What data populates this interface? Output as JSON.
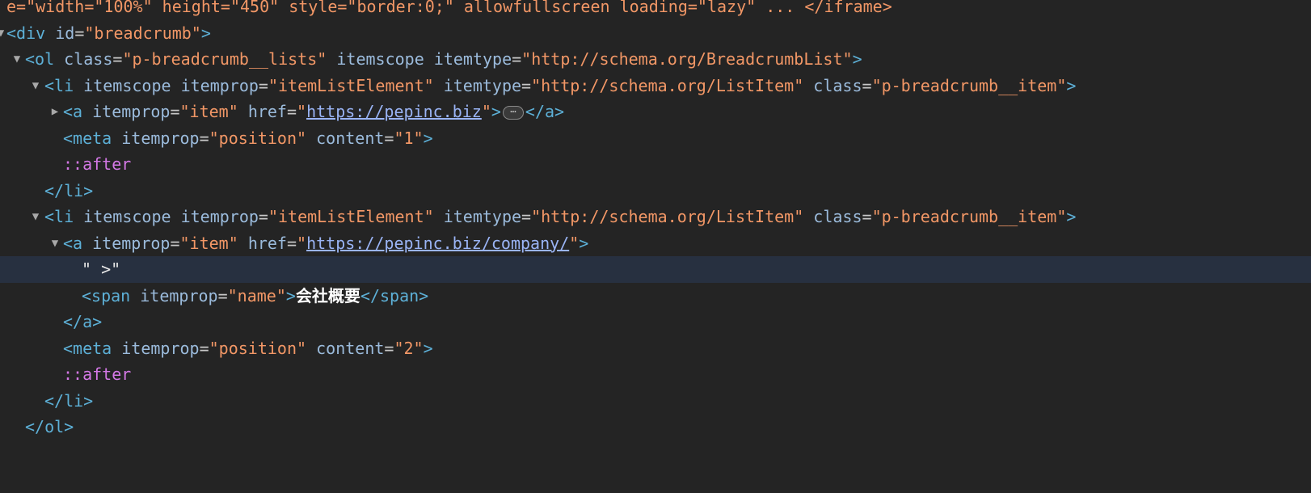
{
  "top_cut_line": "e=\"width=\"100%\" height=\"450\" style=\"border:0;\" allowfullscreen loading=\"lazy\" ... </iframe>",
  "rows": {
    "div_open": {
      "open": "<div",
      "attr": "id",
      "value": "\"breadcrumb\"",
      "close": ">"
    },
    "ol_open": {
      "open": "<ol",
      "attr1": "class",
      "val1": "\"p-breadcrumb__lists\"",
      "attr2": "itemscope",
      "attr3": "itemtype",
      "val3": "\"http://schema.org/BreadcrumbList\"",
      "close": ">"
    },
    "li1_open": {
      "open": "<li",
      "attr1": "itemscope",
      "attr2": "itemprop",
      "val2": "\"itemListElement\"",
      "attr3": "itemtype",
      "val3": "\"http://schema.org/ListItem\"",
      "attr4": "class",
      "val4": "\"p-breadcrumb__item\"",
      "close": ">"
    },
    "a1": {
      "open": "<a",
      "attr1": "itemprop",
      "val1": "\"item\"",
      "attr2": "href",
      "href": "https://pepinc.biz",
      "close_open": ">",
      "ellipsis": "⋯",
      "end_tag": "</a>"
    },
    "meta1": {
      "open": "<meta",
      "attr1": "itemprop",
      "val1": "\"position\"",
      "attr2": "content",
      "val2": "\"1\"",
      "close": ">"
    },
    "after1": "::after",
    "li1_close": "</li>",
    "li2_open": {
      "open": "<li",
      "attr1": "itemscope",
      "attr2": "itemprop",
      "val2": "\"itemListElement\"",
      "attr3": "itemtype",
      "val3": "\"http://schema.org/ListItem\"",
      "attr4": "class",
      "val4": "\"p-breadcrumb__item\"",
      "close": ">"
    },
    "a2_open": {
      "open": "<a",
      "attr1": "itemprop",
      "val1": "\"item\"",
      "attr2": "href",
      "href": "https://pepinc.biz/company/",
      "close": ">"
    },
    "text_node": "\" >\"",
    "span": {
      "open": "<span",
      "attr1": "itemprop",
      "val1": "\"name\"",
      "close_open": ">",
      "text": "会社概要",
      "end_tag": "</span>"
    },
    "a2_close": "</a>",
    "meta2": {
      "open": "<meta",
      "attr1": "itemprop",
      "val1": "\"position\"",
      "attr2": "content",
      "val2": "\"2\"",
      "close": ">"
    },
    "after2": "::after",
    "li2_close": "</li>",
    "ol_close": "</ol>"
  },
  "equals": "=",
  "colors": {
    "background": "#242424",
    "selected_row": "#273040",
    "tag": "#5db0d7",
    "attribute": "#9bbbdc",
    "value": "#f29766",
    "link": "#9ab4f5",
    "pseudo": "#d478e6"
  },
  "icons": {
    "expanded": "triangle-down-icon",
    "collapsed": "triangle-right-icon",
    "ellipsis": "ellipsis-badge-icon"
  }
}
